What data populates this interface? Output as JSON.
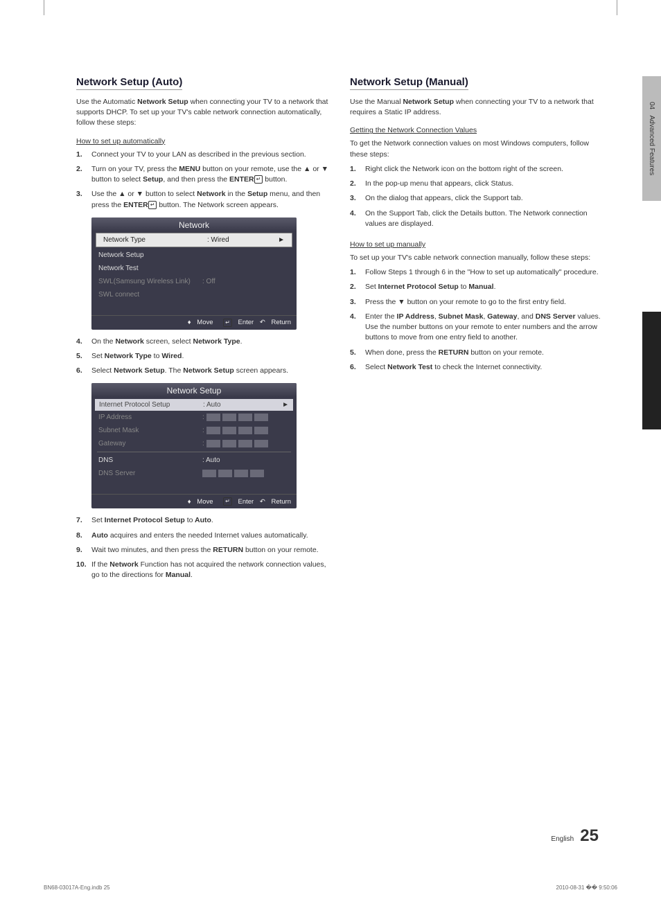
{
  "sideTab": {
    "chapter": "04",
    "label": "Advanced Features"
  },
  "pageFooter": {
    "lang": "English",
    "num": "25"
  },
  "bottomFooter": {
    "left": "BN68-03017A-Eng.indb   25",
    "right": "2010-08-31   �� 9:50:06"
  },
  "left": {
    "title": "Network Setup (Auto)",
    "intro_pre": "Use the Automatic ",
    "intro_bold": "Network Setup",
    "intro_post": " when connecting your TV to a network that supports DHCP. To set up your TV's cable network connection automatically, follow these steps:",
    "sub1": "How to set up automatically",
    "steps1": {
      "s1": "Connect your TV to your LAN as described in the previous section.",
      "s2_a": "Turn on your TV, press the ",
      "s2_b": "MENU",
      "s2_c": " button on your remote, use the ▲ or ▼ button to select ",
      "s2_d": "Setup",
      "s2_e": ", and then press the ",
      "s2_f": "ENTER",
      "s2_g": " button.",
      "s3_a": "Use the ▲ or ▼ button to select ",
      "s3_b": "Network",
      "s3_c": " in the ",
      "s3_d": "Setup",
      "s3_e": " menu, and then press the ",
      "s3_f": "ENTER",
      "s3_g": " button. The Network screen appears."
    },
    "ui1": {
      "title": "Network",
      "r1_label": "Network Type",
      "r1_value": ": Wired",
      "r2": "Network Setup",
      "r3": "Network Test",
      "r4_label": "SWL(Samsung Wireless Link)",
      "r4_value": ": Off",
      "r5": "SWL connect",
      "footer": {
        "move": "Move",
        "enter": "Enter",
        "return": "Return"
      }
    },
    "steps2": {
      "s4_a": "On the",
      "s4_b": " Network ",
      "s4_c": "screen, select",
      "s4_d": " Network Type",
      "s4_e": ".",
      "s5_a": "Set",
      "s5_b": " Network Type ",
      "s5_c": "to",
      "s5_d": " Wired",
      "s5_e": ".",
      "s6_a": "Select",
      "s6_b": " Network Setup",
      "s6_c": ". The",
      "s6_d": " Network Setup ",
      "s6_e": "screen appears."
    },
    "ui2": {
      "title": "Network Setup",
      "r1_label": "Internet Protocol Setup",
      "r1_value": ": Auto",
      "r2": "IP Address",
      "r3": "Subnet Mask",
      "r4": "Gateway",
      "r5_label": "DNS",
      "r5_value": ": Auto",
      "r6": "DNS Server",
      "footer": {
        "move": "Move",
        "enter": "Enter",
        "return": "Return"
      }
    },
    "steps3": {
      "s7_a": "Set",
      "s7_b": " Internet Protocol Setup ",
      "s7_c": "to",
      "s7_d": " Auto",
      "s7_e": ".",
      "s8_a": "Auto",
      "s8_b": " acquires and enters the needed Internet values automatically.",
      "s9_a": "Wait two minutes, and then press the ",
      "s9_b": "RETURN",
      "s9_c": " button on your remote.",
      "s10_a": "If the",
      "s10_b": " Network ",
      "s10_c": "Function has not acquired the network connection values, go to the directions for",
      "s10_d": " Manual",
      "s10_e": "."
    }
  },
  "right": {
    "title": "Network Setup (Manual)",
    "intro_pre": "Use the Manual ",
    "intro_bold": "Network Setup",
    "intro_post": " when connecting your TV to a network that requires a Static IP address.",
    "sub1": "Getting the Network Connection Values",
    "para1": "To get the Network connection values on most Windows computers, follow these steps:",
    "stepsA": {
      "s1": "Right click the Network icon on the bottom right of the screen.",
      "s2": "In the pop-up menu that appears, click Status.",
      "s3": "On the dialog that appears, click the Support tab.",
      "s4": "On the Support Tab, click the Details button. The Network connection values are displayed."
    },
    "sub2": "How to set up manually",
    "para2": "To set up your TV's cable network connection manually, follow these steps:",
    "stepsB": {
      "s1": "Follow Steps 1 through 6 in the \"How to set up automatically\" procedure.",
      "s2_a": "Set",
      "s2_b": " Internet Protocol Setup ",
      "s2_c": "to",
      "s2_d": " Manual",
      "s2_e": ".",
      "s3": "Press the ▼ button on your remote to go to the first entry field.",
      "s4_a": "Enter the",
      "s4_b": " IP Address",
      "s4_c": ",",
      "s4_d": " Subnet Mask",
      "s4_e": ",",
      "s4_f": " Gateway",
      "s4_g": ", and",
      "s4_h": " DNS Server ",
      "s4_i": "values. Use the number buttons on your remote to enter numbers and the arrow buttons to move from one entry field to another.",
      "s5_a": "When done, press the ",
      "s5_b": "RETURN",
      "s5_c": " button on your remote.",
      "s6_a": "Select",
      "s6_b": " Network Test ",
      "s6_c": "to check the Internet connectivity."
    }
  }
}
